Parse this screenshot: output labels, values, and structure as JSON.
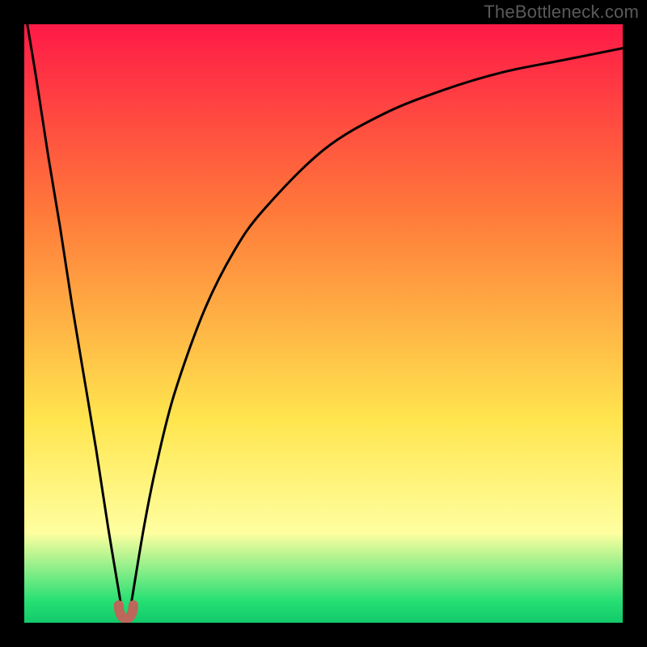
{
  "watermark": "TheBottleneck.com",
  "colors": {
    "frame": "#000000",
    "curve": "#000000",
    "marker_stroke": "#bb6759",
    "marker_fill": "#bb6759",
    "gradient_top": "#ff1744",
    "gradient_mid_orange": "#ff7b3a",
    "gradient_mid_yellow": "#ffe64f",
    "gradient_lemon": "#ffffa0",
    "gradient_green": "#24df73",
    "gradient_green_edge": "#13c96a"
  },
  "chart_data": {
    "type": "line",
    "title": "",
    "xlabel": "",
    "ylabel": "",
    "xlim": [
      0,
      100
    ],
    "ylim": [
      0,
      100
    ],
    "grid": false,
    "legend": false,
    "note": "Axes have no visible tick labels; curve values are read off the background gradient where y≈0 is green (bottom) and y≈100 is red (top). x is normalized left→right.",
    "series": [
      {
        "name": "bottleneck-curve",
        "x": [
          0,
          2,
          4,
          6,
          8,
          10,
          12,
          14,
          16,
          16.5,
          17,
          17.5,
          18,
          20,
          22,
          25,
          30,
          35,
          40,
          50,
          60,
          70,
          80,
          90,
          100
        ],
        "values": [
          103,
          91,
          78,
          66,
          53,
          41,
          29,
          16,
          4,
          1,
          0.5,
          1,
          4,
          16,
          26,
          38,
          52,
          62,
          69,
          79,
          85,
          89,
          92,
          94,
          96
        ]
      }
    ],
    "minimum_marker": {
      "x": 17,
      "y": 0.5
    },
    "background_gradient_stops": [
      {
        "pos": 0.0,
        "label": "red",
        "hex": "#ff1a47"
      },
      {
        "pos": 0.32,
        "label": "orange",
        "hex": "#ff7b3a"
      },
      {
        "pos": 0.66,
        "label": "yellow",
        "hex": "#ffe54e"
      },
      {
        "pos": 0.85,
        "label": "lemon",
        "hex": "#ffffa0"
      },
      {
        "pos": 0.965,
        "label": "green",
        "hex": "#24df73"
      },
      {
        "pos": 1.0,
        "label": "green2",
        "hex": "#13c96a"
      }
    ]
  }
}
